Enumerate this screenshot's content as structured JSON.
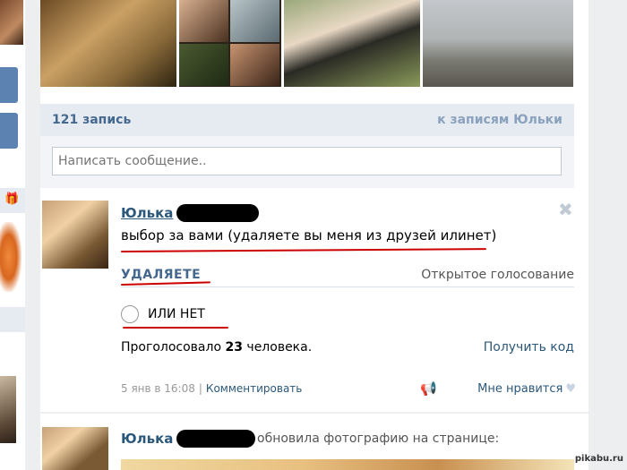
{
  "wall": {
    "count_label": "121 запись",
    "to_posts_link": "к записям Юльки",
    "compose_placeholder": "Написать сообщение.."
  },
  "post": {
    "author": "Юлька",
    "text": "выбор за вами (удаляете вы меня из друзей илинет)",
    "poll": {
      "option_title": "УДАЛЯЕТЕ",
      "type_label": "Открытое голосование",
      "option_label": "ИЛИ НЕТ",
      "voted_prefix": "Проголосовало",
      "voted_count": "23",
      "voted_suffix": "человека.",
      "get_code": "Получить код"
    },
    "date": "5 янв в 16:08",
    "comment_link": "Комментировать",
    "like_label": "Мне нравится"
  },
  "post2": {
    "author": "Юлька",
    "action": "обновила фотографию на странице:"
  },
  "watermark": "pikabu.ru",
  "colors": {
    "link": "#2b587a",
    "header_bg": "#e5ebf1",
    "highlight": "#cc0000"
  }
}
